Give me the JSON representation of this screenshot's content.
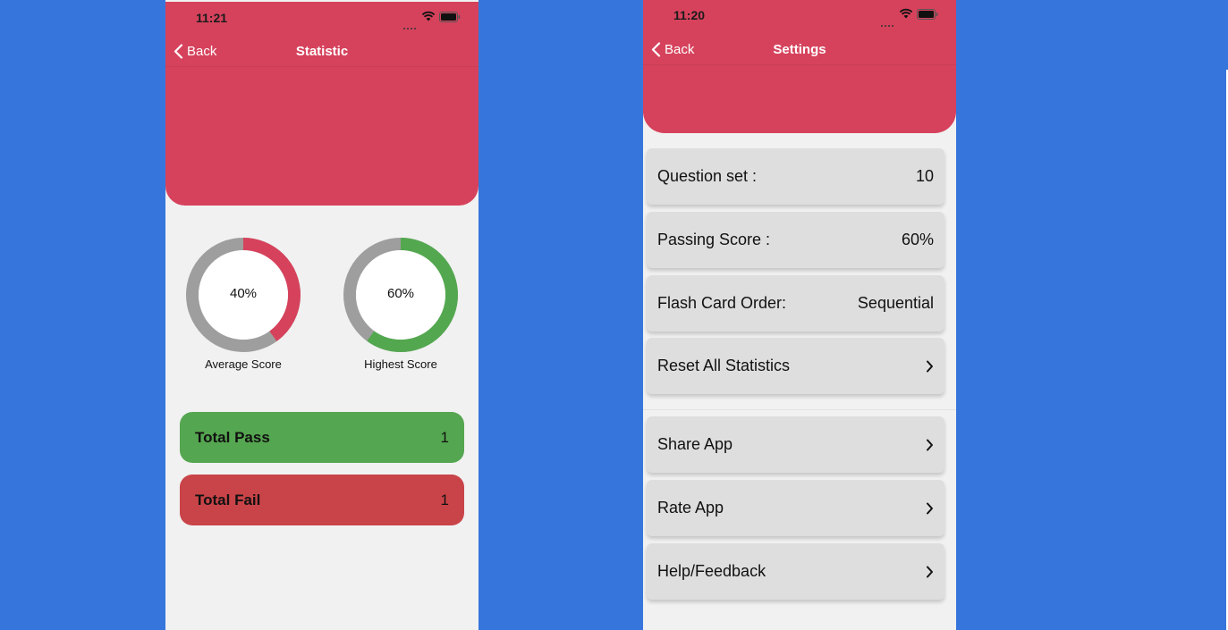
{
  "statistic": {
    "time": "11:21",
    "back_label": "Back",
    "title": "Statistic",
    "colors": {
      "header": "#d6425c",
      "pass": "#55a650",
      "fail": "#c94448",
      "ring_track": "#9e9e9e",
      "avg_ring": "#d6425c",
      "high_ring": "#53a84f"
    },
    "average": {
      "value_text": "40%",
      "percent": 40,
      "label": "Average Score"
    },
    "highest": {
      "value_text": "60%",
      "percent": 60,
      "label": "Highest Score"
    },
    "total_pass": {
      "label": "Total Pass",
      "value": "1"
    },
    "total_fail": {
      "label": "Total Fail",
      "value": "1"
    }
  },
  "settings": {
    "time": "11:20",
    "back_label": "Back",
    "title": "Settings",
    "items": [
      {
        "label": "Question set :",
        "value": "10"
      },
      {
        "label": "Passing Score :",
        "value": "60%"
      },
      {
        "label": "Flash Card Order:",
        "value": "Sequential"
      },
      {
        "label": "Reset All Statistics",
        "icon": "chevron-right-icon"
      },
      {
        "label": "Share App",
        "icon": "chevron-right-icon"
      },
      {
        "label": "Rate App",
        "icon": "chevron-right-icon"
      },
      {
        "label": "Help/Feedback",
        "icon": "chevron-right-icon"
      }
    ]
  }
}
